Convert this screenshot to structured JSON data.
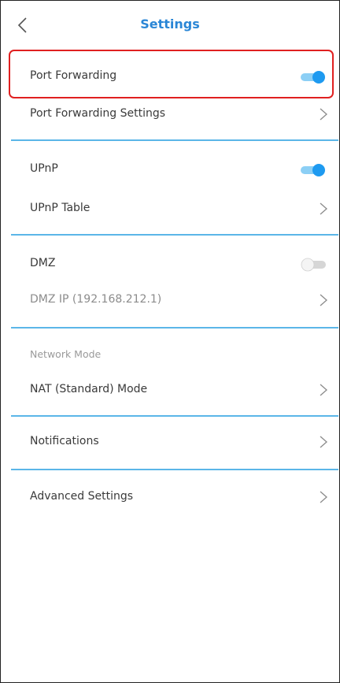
{
  "header": {
    "title": "Settings",
    "back_icon": "chevron-left-icon"
  },
  "rows": {
    "port_forwarding": {
      "label": "Port Forwarding",
      "toggle_on": true
    },
    "port_forwarding_settings": {
      "label": "Port Forwarding Settings"
    },
    "upnp": {
      "label": "UPnP",
      "toggle_on": true
    },
    "upnp_table": {
      "label": "UPnP Table"
    },
    "dmz": {
      "label": "DMZ",
      "toggle_on": false
    },
    "dmz_ip": {
      "label": "DMZ IP (192.168.212.1)"
    },
    "network_mode_section": {
      "label": "Network Mode"
    },
    "nat_mode": {
      "label": "NAT (Standard) Mode"
    },
    "notifications": {
      "label": "Notifications"
    },
    "advanced_settings": {
      "label": "Advanced Settings"
    }
  },
  "colors": {
    "accent": "#2a86d6",
    "toggle_on": "#1e9af0",
    "toggle_off": "#cfcfcf",
    "divider": "#5bb6e8",
    "highlight": "#e02020"
  }
}
